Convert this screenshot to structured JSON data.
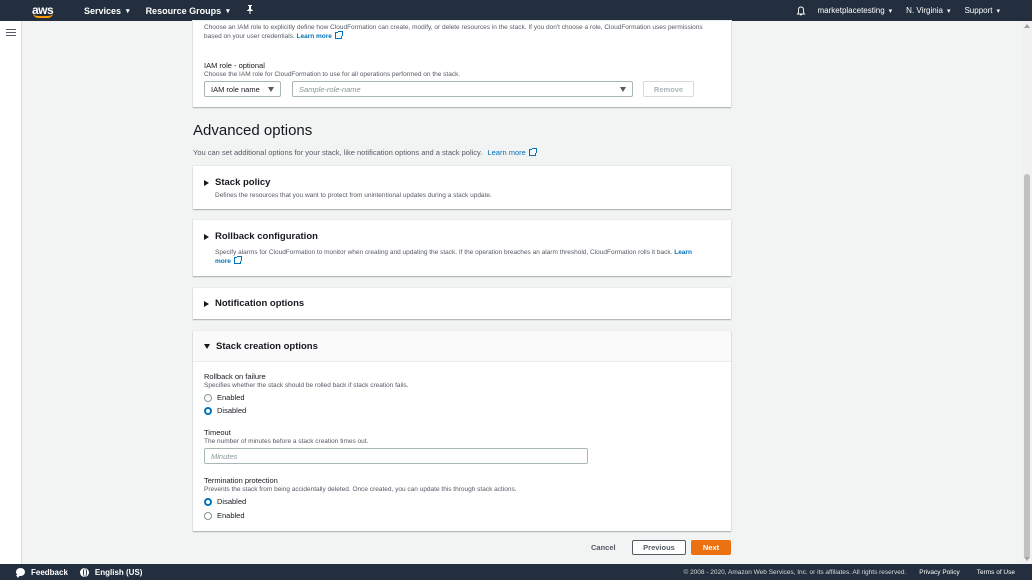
{
  "topnav": {
    "logo_text": "aws",
    "services": "Services",
    "resource_groups": "Resource Groups",
    "account": "marketplacetesting",
    "region": "N. Virginia",
    "support": "Support"
  },
  "iam": {
    "description": "Choose an IAM role to explicitly define how CloudFormation can create, modify, or delete resources in the stack. If you don't choose a role, CloudFormation uses permissions based on your user credentials.",
    "learn_more": "Learn more",
    "role_label": "IAM role - optional",
    "role_sub": "Choose the IAM role for CloudFormation to use for all operations performed on the stack.",
    "select_value": "IAM role name",
    "input_placeholder": "Sample-role-name",
    "remove": "Remove"
  },
  "advanced": {
    "title": "Advanced options",
    "description": "You can set additional options for your stack, like notification options and a stack policy.",
    "learn_more": "Learn more"
  },
  "stack_policy": {
    "title": "Stack policy",
    "description": "Defines the resources that you want to protect from unintentional updates during a stack update."
  },
  "rollback_config": {
    "title": "Rollback configuration",
    "description": "Specify alarms for CloudFormation to monitor when creating and updating the stack. If the operation breaches an alarm threshold, CloudFormation rolls it back.",
    "learn": "Learn",
    "more": "more"
  },
  "notification": {
    "title": "Notification options"
  },
  "stack_creation": {
    "title": "Stack creation options",
    "rollback_label": "Rollback on failure",
    "rollback_sub": "Specifies whether the stack should be rolled back if stack creation fails.",
    "rollback_options": [
      "Enabled",
      "Disabled"
    ],
    "rollback_selected": "Disabled",
    "timeout_label": "Timeout",
    "timeout_sub": "The number of minutes before a stack creation times out.",
    "timeout_placeholder": "Minutes",
    "termination_label": "Termination protection",
    "termination_sub": "Prevents the stack from being accidentally deleted. Once created, you can update this through stack actions.",
    "termination_options": [
      "Disabled",
      "Enabled"
    ],
    "termination_selected": "Disabled"
  },
  "actions": {
    "cancel": "Cancel",
    "previous": "Previous",
    "next": "Next"
  },
  "footer": {
    "feedback": "Feedback",
    "language": "English (US)",
    "copyright": "© 2008 - 2020, Amazon Web Services, Inc. or its affiliates. All rights reserved.",
    "privacy": "Privacy Policy",
    "terms": "Terms of Use"
  },
  "colors": {
    "nav_bg": "#232f3e",
    "link": "#0073bb",
    "primary_button": "#ec7211"
  }
}
